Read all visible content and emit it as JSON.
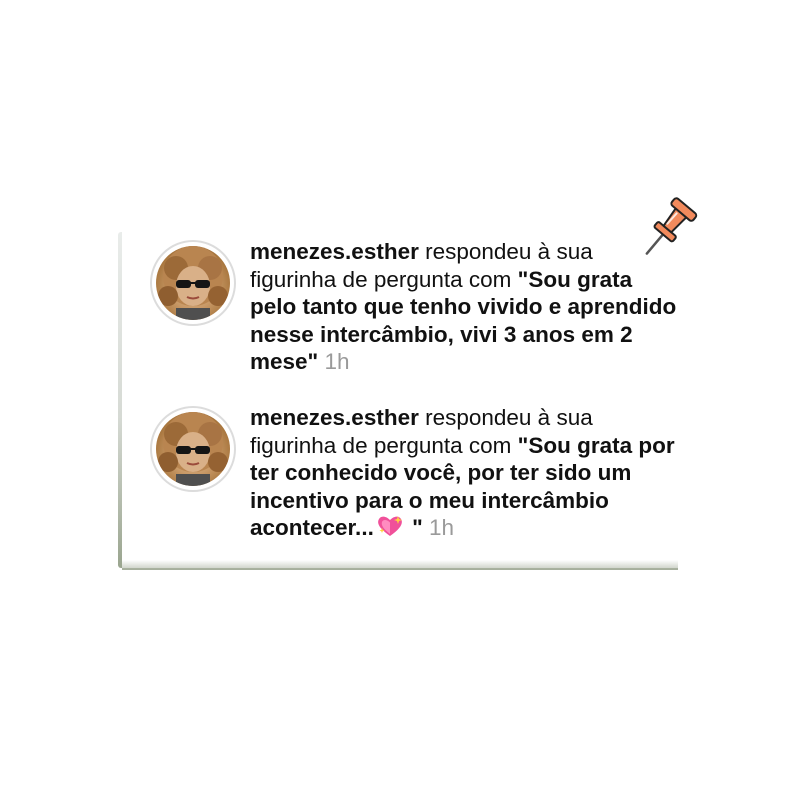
{
  "notifications": [
    {
      "username": "menezes.esther",
      "action": " respondeu à sua figurinha de pergunta com ",
      "quote": "\"Sou grata pelo tanto que tenho vivido e aprendido nesse intercâmbio, vivi 3 anos em 2 mese\"",
      "time": "1h",
      "avatar_icon": "profile-photo"
    },
    {
      "username": "menezes.esther",
      "action": " respondeu à sua figurinha de pergunta com ",
      "quote": "\"Sou grata por ter conhecido você, por ter sido um incentivo para o meu intercâmbio acontecer...",
      "quote_end": " \"",
      "emoji": "sparkling-heart",
      "time": "1h",
      "avatar_icon": "profile-photo"
    }
  ],
  "decorations": {
    "pin_icon": "push-pin",
    "pin_color": "#f28a5c"
  }
}
